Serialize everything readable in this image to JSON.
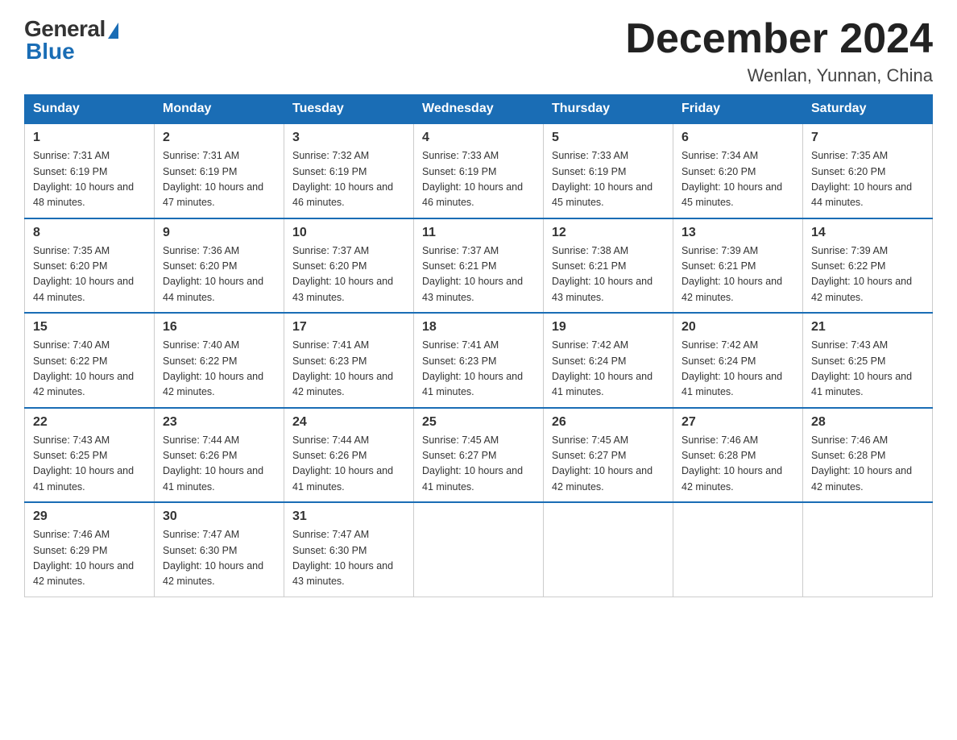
{
  "header": {
    "month_title": "December 2024",
    "location": "Wenlan, Yunnan, China"
  },
  "logo": {
    "general": "General",
    "blue": "Blue"
  },
  "days_of_week": [
    "Sunday",
    "Monday",
    "Tuesday",
    "Wednesday",
    "Thursday",
    "Friday",
    "Saturday"
  ],
  "weeks": [
    [
      {
        "day": "1",
        "sunrise": "Sunrise: 7:31 AM",
        "sunset": "Sunset: 6:19 PM",
        "daylight": "Daylight: 10 hours and 48 minutes."
      },
      {
        "day": "2",
        "sunrise": "Sunrise: 7:31 AM",
        "sunset": "Sunset: 6:19 PM",
        "daylight": "Daylight: 10 hours and 47 minutes."
      },
      {
        "day": "3",
        "sunrise": "Sunrise: 7:32 AM",
        "sunset": "Sunset: 6:19 PM",
        "daylight": "Daylight: 10 hours and 46 minutes."
      },
      {
        "day": "4",
        "sunrise": "Sunrise: 7:33 AM",
        "sunset": "Sunset: 6:19 PM",
        "daylight": "Daylight: 10 hours and 46 minutes."
      },
      {
        "day": "5",
        "sunrise": "Sunrise: 7:33 AM",
        "sunset": "Sunset: 6:19 PM",
        "daylight": "Daylight: 10 hours and 45 minutes."
      },
      {
        "day": "6",
        "sunrise": "Sunrise: 7:34 AM",
        "sunset": "Sunset: 6:20 PM",
        "daylight": "Daylight: 10 hours and 45 minutes."
      },
      {
        "day": "7",
        "sunrise": "Sunrise: 7:35 AM",
        "sunset": "Sunset: 6:20 PM",
        "daylight": "Daylight: 10 hours and 44 minutes."
      }
    ],
    [
      {
        "day": "8",
        "sunrise": "Sunrise: 7:35 AM",
        "sunset": "Sunset: 6:20 PM",
        "daylight": "Daylight: 10 hours and 44 minutes."
      },
      {
        "day": "9",
        "sunrise": "Sunrise: 7:36 AM",
        "sunset": "Sunset: 6:20 PM",
        "daylight": "Daylight: 10 hours and 44 minutes."
      },
      {
        "day": "10",
        "sunrise": "Sunrise: 7:37 AM",
        "sunset": "Sunset: 6:20 PM",
        "daylight": "Daylight: 10 hours and 43 minutes."
      },
      {
        "day": "11",
        "sunrise": "Sunrise: 7:37 AM",
        "sunset": "Sunset: 6:21 PM",
        "daylight": "Daylight: 10 hours and 43 minutes."
      },
      {
        "day": "12",
        "sunrise": "Sunrise: 7:38 AM",
        "sunset": "Sunset: 6:21 PM",
        "daylight": "Daylight: 10 hours and 43 minutes."
      },
      {
        "day": "13",
        "sunrise": "Sunrise: 7:39 AM",
        "sunset": "Sunset: 6:21 PM",
        "daylight": "Daylight: 10 hours and 42 minutes."
      },
      {
        "day": "14",
        "sunrise": "Sunrise: 7:39 AM",
        "sunset": "Sunset: 6:22 PM",
        "daylight": "Daylight: 10 hours and 42 minutes."
      }
    ],
    [
      {
        "day": "15",
        "sunrise": "Sunrise: 7:40 AM",
        "sunset": "Sunset: 6:22 PM",
        "daylight": "Daylight: 10 hours and 42 minutes."
      },
      {
        "day": "16",
        "sunrise": "Sunrise: 7:40 AM",
        "sunset": "Sunset: 6:22 PM",
        "daylight": "Daylight: 10 hours and 42 minutes."
      },
      {
        "day": "17",
        "sunrise": "Sunrise: 7:41 AM",
        "sunset": "Sunset: 6:23 PM",
        "daylight": "Daylight: 10 hours and 42 minutes."
      },
      {
        "day": "18",
        "sunrise": "Sunrise: 7:41 AM",
        "sunset": "Sunset: 6:23 PM",
        "daylight": "Daylight: 10 hours and 41 minutes."
      },
      {
        "day": "19",
        "sunrise": "Sunrise: 7:42 AM",
        "sunset": "Sunset: 6:24 PM",
        "daylight": "Daylight: 10 hours and 41 minutes."
      },
      {
        "day": "20",
        "sunrise": "Sunrise: 7:42 AM",
        "sunset": "Sunset: 6:24 PM",
        "daylight": "Daylight: 10 hours and 41 minutes."
      },
      {
        "day": "21",
        "sunrise": "Sunrise: 7:43 AM",
        "sunset": "Sunset: 6:25 PM",
        "daylight": "Daylight: 10 hours and 41 minutes."
      }
    ],
    [
      {
        "day": "22",
        "sunrise": "Sunrise: 7:43 AM",
        "sunset": "Sunset: 6:25 PM",
        "daylight": "Daylight: 10 hours and 41 minutes."
      },
      {
        "day": "23",
        "sunrise": "Sunrise: 7:44 AM",
        "sunset": "Sunset: 6:26 PM",
        "daylight": "Daylight: 10 hours and 41 minutes."
      },
      {
        "day": "24",
        "sunrise": "Sunrise: 7:44 AM",
        "sunset": "Sunset: 6:26 PM",
        "daylight": "Daylight: 10 hours and 41 minutes."
      },
      {
        "day": "25",
        "sunrise": "Sunrise: 7:45 AM",
        "sunset": "Sunset: 6:27 PM",
        "daylight": "Daylight: 10 hours and 41 minutes."
      },
      {
        "day": "26",
        "sunrise": "Sunrise: 7:45 AM",
        "sunset": "Sunset: 6:27 PM",
        "daylight": "Daylight: 10 hours and 42 minutes."
      },
      {
        "day": "27",
        "sunrise": "Sunrise: 7:46 AM",
        "sunset": "Sunset: 6:28 PM",
        "daylight": "Daylight: 10 hours and 42 minutes."
      },
      {
        "day": "28",
        "sunrise": "Sunrise: 7:46 AM",
        "sunset": "Sunset: 6:28 PM",
        "daylight": "Daylight: 10 hours and 42 minutes."
      }
    ],
    [
      {
        "day": "29",
        "sunrise": "Sunrise: 7:46 AM",
        "sunset": "Sunset: 6:29 PM",
        "daylight": "Daylight: 10 hours and 42 minutes."
      },
      {
        "day": "30",
        "sunrise": "Sunrise: 7:47 AM",
        "sunset": "Sunset: 6:30 PM",
        "daylight": "Daylight: 10 hours and 42 minutes."
      },
      {
        "day": "31",
        "sunrise": "Sunrise: 7:47 AM",
        "sunset": "Sunset: 6:30 PM",
        "daylight": "Daylight: 10 hours and 43 minutes."
      },
      null,
      null,
      null,
      null
    ]
  ]
}
